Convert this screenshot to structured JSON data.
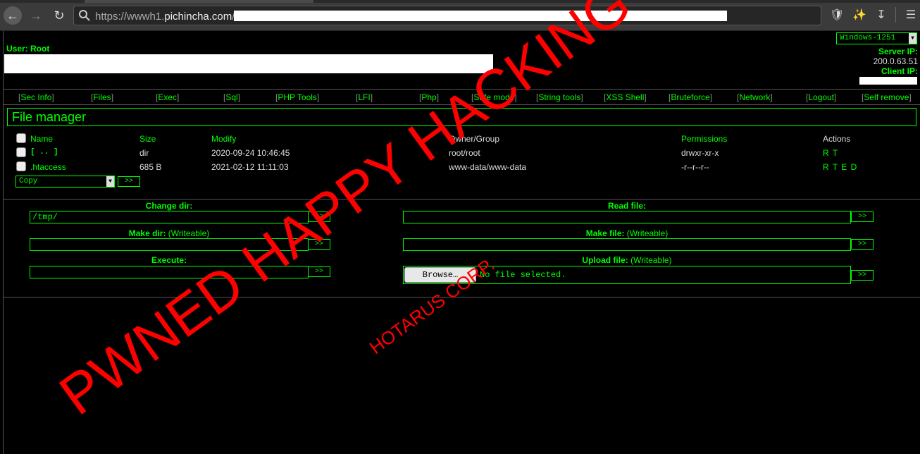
{
  "browser": {
    "url_prefix": "https://wwwh1.",
    "url_domain": "pichincha.com",
    "url_suffix": "/"
  },
  "header": {
    "user_label": "User: Root",
    "encoding": "Windows-1251",
    "server_ip_label": "Server IP:",
    "server_ip": "200.0.63.51",
    "client_ip_label": "Client IP:"
  },
  "menu": [
    "Sec Info",
    "Files",
    "Exec",
    "Sql",
    "PHP Tools",
    "LFI",
    "Php",
    "Safe mode",
    "String tools",
    "XSS Shell",
    "Bruteforce",
    "Network",
    "Logout",
    "Self remove"
  ],
  "file_manager": {
    "title": "File manager",
    "columns": [
      "Name",
      "Size",
      "Modify",
      "Owner/Group",
      "Permissions",
      "Actions"
    ],
    "rows": [
      {
        "name": "[ .. ]",
        "size": "dir",
        "modify": "2020-09-24 10:46:45",
        "owner": "root/root",
        "perms": "drwxr-xr-x",
        "actions": "R T"
      },
      {
        "name": ".htaccess",
        "size": "685 B",
        "modify": "2021-02-12 11:11:03",
        "owner": "www-data/www-data",
        "perms": "-r--r--r--",
        "actions": "R T E D"
      }
    ],
    "action_select": "Copy",
    "go": ">>"
  },
  "forms": {
    "change_dir": "Change dir:",
    "change_dir_value": "/tmp/",
    "make_dir": "Make dir:",
    "writeable": "(Writeable)",
    "execute": "Execute:",
    "read_file": "Read file:",
    "make_file": "Make file:",
    "upload_file": "Upload file:",
    "browse": "Browse…",
    "no_file": "No file selected.",
    "go": ">>"
  },
  "watermark": {
    "main": "PWNED HAPPY HACKING",
    "sub": "HOTARUS CORP."
  },
  "colors": {
    "accent": "#00ff00",
    "watermark": "#ff0000",
    "background": "#000000"
  }
}
